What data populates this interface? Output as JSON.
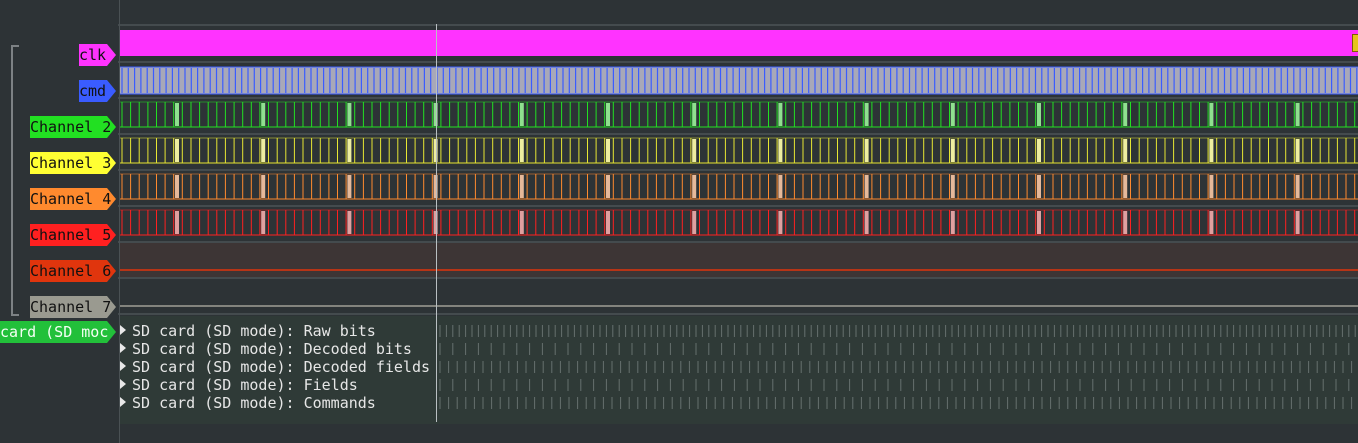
{
  "channels": [
    {
      "label": "clk",
      "color": "#ff33ff"
    },
    {
      "label": "cmd",
      "color": "#3a5cff"
    },
    {
      "label": "Channel 2",
      "color": "#22e022"
    },
    {
      "label": "Channel 3",
      "color": "#ffff33"
    },
    {
      "label": "Channel 4",
      "color": "#ff8a2e"
    },
    {
      "label": "Channel 5",
      "color": "#ff2020"
    },
    {
      "label": "Channel 6",
      "color": "#e0350d"
    },
    {
      "label": "Channel 7",
      "color": "#9a9a90"
    }
  ],
  "decoder": {
    "label": "card (SD moc",
    "color": "#22c03a",
    "rows": [
      {
        "label": "SD card (SD mode): Raw bits"
      },
      {
        "label": "SD card (SD mode): Decoded bits"
      },
      {
        "label": "SD card (SD mode): Decoded fields"
      },
      {
        "label": "SD card (SD mode): Fields"
      },
      {
        "label": "SD card (SD mode): Commands"
      }
    ]
  }
}
